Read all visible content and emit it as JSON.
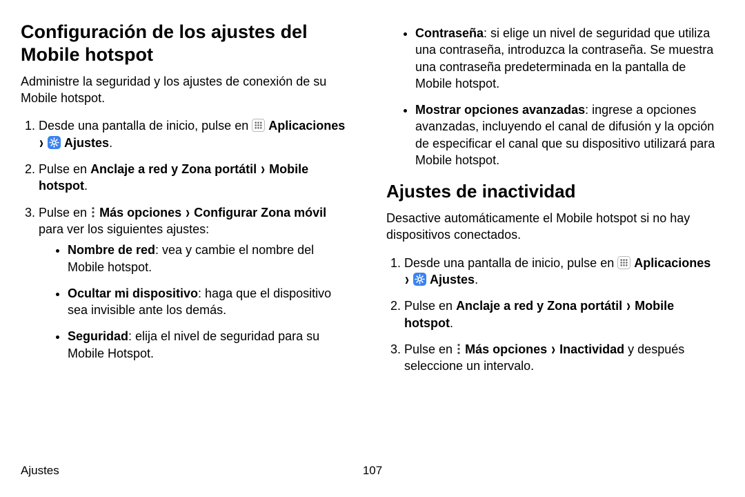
{
  "leftCol": {
    "heading": "Configuración de los ajustes del Mobile hotspot",
    "intro": "Administre la seguridad y los ajustes de conexión de su Mobile hotspot.",
    "step1_a": "Desde una pantalla de inicio, pulse en ",
    "apps_label": "Aplicaciones",
    "settings_label": "Ajustes",
    "chevron": "›",
    "period": ".",
    "step2_a": "Pulse en ",
    "step2_b": "Anclaje a red y Zona portátil",
    "step2_c": "Mobile hotspot",
    "step3_a": "Pulse en ",
    "step3_b": "Más opciones",
    "step3_c": "Configurar Zona móvil",
    "step3_d": " para ver los siguientes ajustes:",
    "bullet1_b": "Nombre de red",
    "bullet1_t": ": vea y cambie el nombre del Mobile hotspot.",
    "bullet2_b": "Ocultar mi dispositivo",
    "bullet2_t": ": haga que el dispositivo sea invisible ante los demás.",
    "bullet3_b": "Seguridad",
    "bullet3_t": ": elija el nivel de seguridad para su Mobile Hotspot."
  },
  "rightCol": {
    "bullet4_b": "Contraseña",
    "bullet4_t": ": si elige un nivel de seguridad que utiliza una contraseña, introduzca la contraseña. Se muestra una contraseña predeterminada en la pantalla de Mobile hotspot.",
    "bullet5_b": "Mostrar opciones avanzadas",
    "bullet5_t": ": ingrese a opciones avanzadas, incluyendo el canal de difusión y la opción de especificar el canal que su dispositivo utilizará para Mobile hotspot.",
    "heading2": "Ajustes de inactividad",
    "intro2": "Desactive automáticamente el Mobile hotspot si no hay dispositivos conectados.",
    "step1_a": "Desde una pantalla de inicio, pulse en ",
    "apps_label": "Aplicaciones",
    "settings_label": "Ajustes",
    "chevron": "›",
    "period": ".",
    "step2_a": "Pulse en ",
    "step2_b": "Anclaje a red y Zona portátil",
    "step2_c": "Mobile hotspot",
    "step3_a": "Pulse en ",
    "step3_b": "Más opciones",
    "step3_c": "Inactividad",
    "step3_d": " y después seleccione un intervalo."
  },
  "footer": {
    "section": "Ajustes",
    "page": "107"
  }
}
